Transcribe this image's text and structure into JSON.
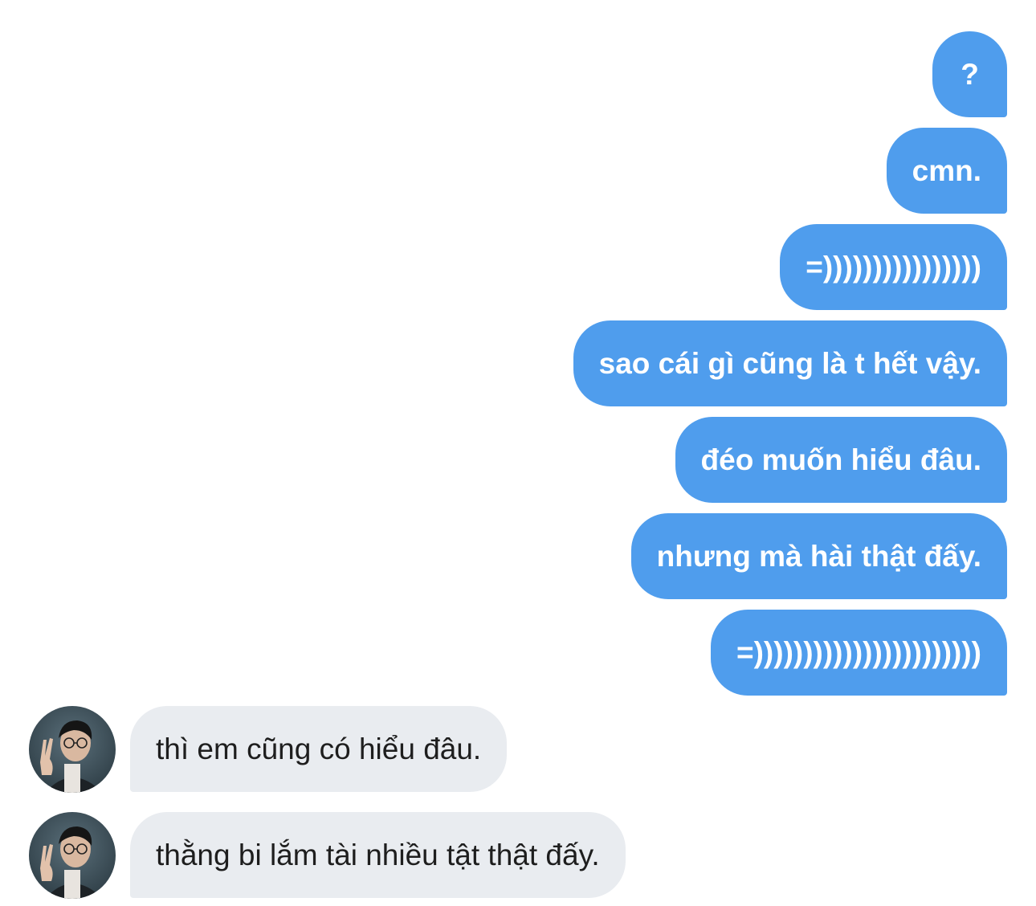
{
  "conversation": {
    "sent_messages": [
      "?",
      "cmn.",
      "=))))))))))))))))",
      "sao cái gì cũng là t hết vậy.",
      "đéo muốn hiểu đâu.",
      "nhưng mà hài thật đấy.",
      "=)))))))))))))))))))))))"
    ],
    "received_messages": [
      "thì em cũng có hiểu đâu.",
      "thằng bi lắm tài nhiều tật thật đấy."
    ],
    "sent_bubble_color": "#4f9ded",
    "received_bubble_color": "#e9ecf0",
    "avatar_icon": "user-avatar-icon"
  }
}
